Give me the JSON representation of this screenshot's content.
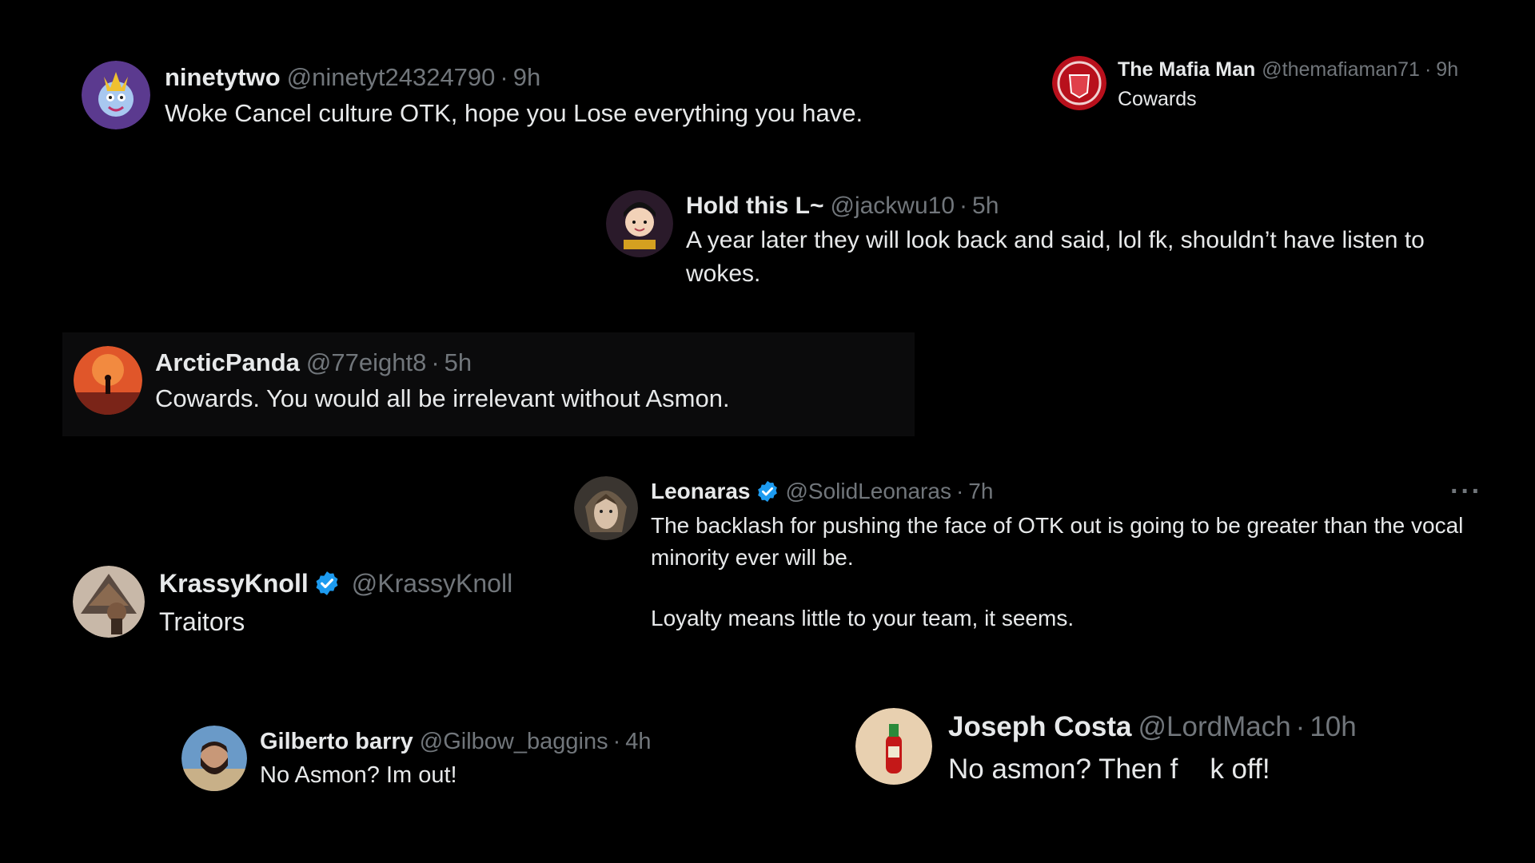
{
  "tweets": [
    {
      "name": "ninetytwo",
      "handle": "@ninetyt24324790",
      "time": "9h",
      "text": "Woke Cancel culture OTK, hope you Lose everything you have."
    },
    {
      "name": "The Mafia Man",
      "handle": "@themafiaman71",
      "time": "9h",
      "text": "Cowards"
    },
    {
      "name": "Hold this L~",
      "handle": "@jackwu10",
      "time": "5h",
      "text": "A year later they will look back and said, lol fk, shouldn’t have listen to wokes."
    },
    {
      "name": "ArcticPanda",
      "handle": "@77eight8",
      "time": "5h",
      "text": "Cowards. You would all be irrelevant without Asmon."
    },
    {
      "name": "Leonaras",
      "handle": "@SolidLeonaras",
      "time": "7h",
      "text": "The backlash for pushing the face of OTK out is going to be greater than the vocal minority ever will be.",
      "text2": "Loyalty means little to your team, it seems.",
      "more": "···"
    },
    {
      "name": "KrassyKnoll",
      "handle": "@KrassyKnoll",
      "text": "Traitors"
    },
    {
      "name": "Gilberto barry",
      "handle": "@Gilbow_baggins",
      "time": "4h",
      "text": "No Asmon? Im out!"
    },
    {
      "name": "Joseph Costa",
      "handle": "@LordMach",
      "time": "10h",
      "text_a": "No asmon? Then f",
      "text_b": "k off!"
    }
  ],
  "colors": {
    "background": "#000000",
    "text": "#e7e9ea",
    "muted": "#71767b",
    "verified": "#1d9bf0",
    "highlight": "#0b0b0c"
  },
  "icons": [
    "verified-badge-icon",
    "more-options-icon"
  ]
}
